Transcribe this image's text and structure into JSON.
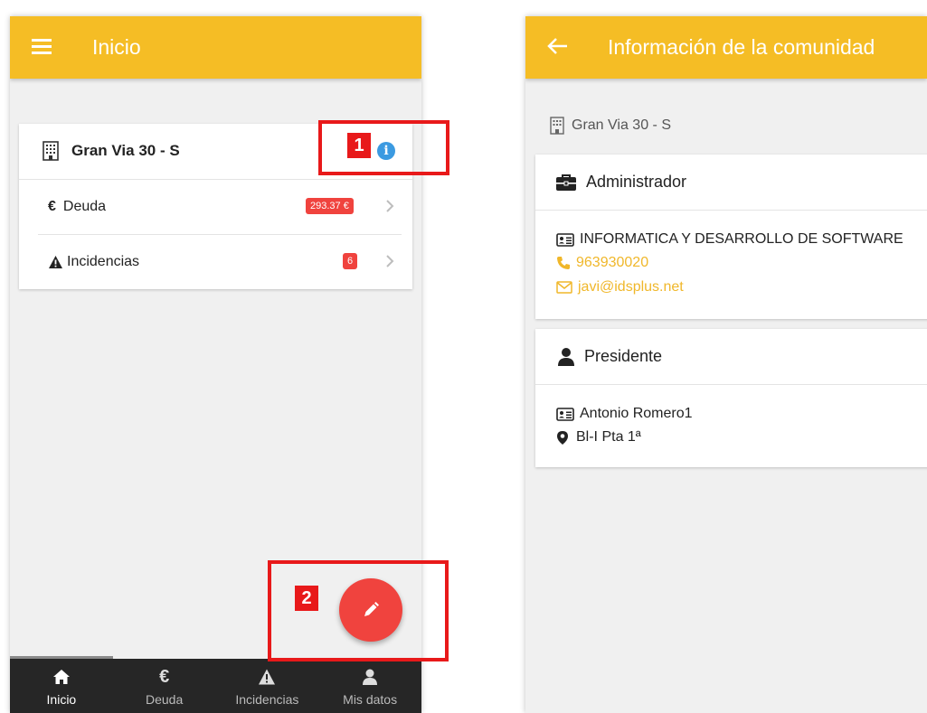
{
  "left_screen": {
    "appbar": {
      "title": "Inicio",
      "menu_icon": "hamburger-menu-icon"
    },
    "card": {
      "community": "Gran Via 30 - S",
      "rows": [
        {
          "label": "Deuda",
          "badge": "293.37 €",
          "icon": "euro-icon"
        },
        {
          "label": "Incidencias",
          "badge": "6",
          "icon": "warning-icon"
        }
      ]
    },
    "callouts": {
      "one": "1",
      "two": "2"
    },
    "bottom_nav": [
      {
        "label": "Inicio",
        "icon": "home-icon",
        "active": true
      },
      {
        "label": "Deuda",
        "icon": "euro-icon",
        "active": false
      },
      {
        "label": "Incidencias",
        "icon": "warning-icon",
        "active": false
      },
      {
        "label": "Mis datos",
        "icon": "user-icon",
        "active": false
      }
    ]
  },
  "right_screen": {
    "appbar": {
      "title": "Información de la comunidad"
    },
    "community": "Gran Via 30 - S",
    "administrador": {
      "title": "Administrador",
      "name": "INFORMATICA Y DESARROLLO DE SOFTWARE",
      "phone": "963930020",
      "email": "javi@idsplus.net"
    },
    "presidente": {
      "title": "Presidente",
      "name": "Antonio Romero1",
      "location": "Bl-I Pta 1ª"
    }
  },
  "colors": {
    "appbar": "#f5bd25",
    "badge": "#f0433e",
    "callout": "#e8191a",
    "info": "#3b9ae1",
    "nav": "#262626",
    "link": "#f0b72a"
  }
}
